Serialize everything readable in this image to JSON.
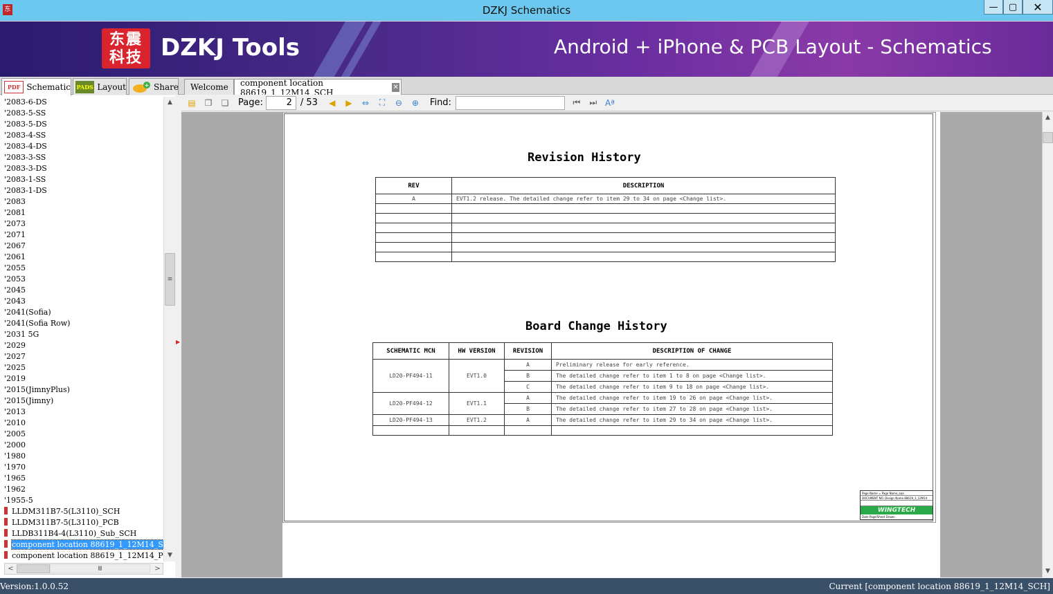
{
  "window": {
    "title": "DZKJ Schematics",
    "app_icon_text": "东",
    "controls": {
      "minimize": "—",
      "maximize": "▢",
      "close": "✕"
    }
  },
  "banner": {
    "logo_text": "东震科技",
    "brand": "DZKJ Tools",
    "tagline": "Android + iPhone & PCB Layout - Schematics"
  },
  "left_tabs": [
    {
      "label": "Schematic",
      "icon": "PDF"
    },
    {
      "label": "Layout",
      "icon": "PADS"
    },
    {
      "label": "Share",
      "icon": "share"
    }
  ],
  "doc_tabs": [
    {
      "label": "Welcome"
    },
    {
      "label": "component location 88619_1_12M14_SCH"
    }
  ],
  "sidebar": {
    "items": [
      "'2083-6-DS",
      "'2083-5-SS",
      "'2083-5-DS",
      "'2083-4-SS",
      "'2083-4-DS",
      "'2083-3-SS",
      "'2083-3-DS",
      "'2083-1-SS",
      "'2083-1-DS",
      "'2083",
      "'2081",
      "'2073",
      "'2071",
      "'2067",
      "'2061",
      "'2055",
      "'2053",
      "'2045",
      "'2043",
      "'2041(Sofia)",
      "'2041(Sofia Row)",
      "'2031 5G",
      "'2029",
      "'2027",
      "'2025",
      "'2019",
      "'2015(JimnyPlus)",
      "'2015(Jimny)",
      "'2013",
      "'2010",
      "'2005",
      "'2000",
      "'1980",
      "'1970",
      "'1965",
      "'1962",
      "'1955-5"
    ],
    "files": [
      "LLDM311B7-5(L3110)_SCH",
      "LLDM311B7-5(L3110)_PCB",
      "LLDB311B4-4(L3110)_Sub_SCH",
      "component location 88619_1_12M14_SCH",
      "component location 88619_1_12M14_PCB"
    ],
    "selected_file": 3
  },
  "toolbar": {
    "page_label": "Page:",
    "page_current": "2",
    "page_total": "/ 53",
    "find_label": "Find:",
    "find_value": ""
  },
  "document": {
    "revision_title": "Revision History",
    "revision_headers": [
      "REV",
      "DESCRIPTION"
    ],
    "revision_rows": [
      [
        "A",
        "EVT1.2 release. The detailed change refer to item 29  to 34 on page <Change list>."
      ],
      [
        "",
        ""
      ],
      [
        "",
        ""
      ],
      [
        "",
        ""
      ],
      [
        "",
        ""
      ],
      [
        "",
        ""
      ],
      [
        "",
        ""
      ]
    ],
    "board_title": "Board Change History",
    "board_headers": [
      "SCHEMATIC MCN",
      "HW VERSION",
      "REVISION",
      "DESCRIPTION OF CHANGE"
    ],
    "board_groups": [
      {
        "mcn": "LD20-PF494-11",
        "hw": "EVT1.0",
        "rows": [
          [
            "A",
            "Preliminary release for early reference."
          ],
          [
            "B",
            "The detailed change refer to item 1 to 8 on page <Change list>."
          ],
          [
            "C",
            "The detailed change refer to item 9 to 18 on page <Change list>."
          ]
        ]
      },
      {
        "mcn": "LD20-PF494-12",
        "hw": "EVT1.1",
        "rows": [
          [
            "A",
            "The detailed change refer to item 19 to 26 on page <Change list>."
          ],
          [
            "B",
            "The detailed change refer to item 27 to 28 on page <Change list>."
          ]
        ]
      },
      {
        "mcn": "LD20-PF494-13",
        "hw": "EVT1.2",
        "rows": [
          [
            "A",
            "The detailed change refer to item 29 to 34 on page <Change list>."
          ]
        ]
      }
    ],
    "titleblock": {
      "line1": "Page Name = Page Name_aaa",
      "line2": "DOCUMENT NO.  Design Name 88619_1_12M14",
      "logo": "WINGTECH",
      "line3": "Date   Page/Sheet  Drawn"
    }
  },
  "status": {
    "version": "Version:1.0.0.52",
    "current": "Current [component location 88619_1_12M14_SCH]"
  }
}
